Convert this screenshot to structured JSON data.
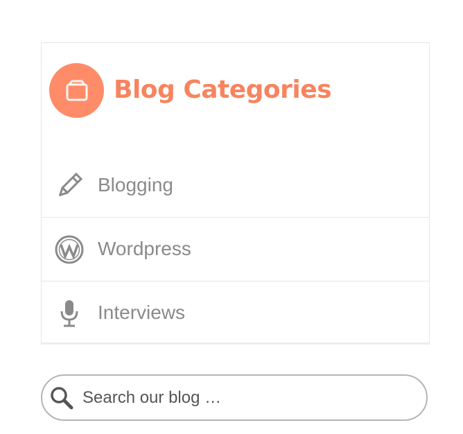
{
  "widget": {
    "title": "Blog Categories",
    "title_icon": "folder-icon",
    "accent_color": "#f7845f",
    "categories": [
      {
        "label": "Blogging",
        "icon": "pencil-icon"
      },
      {
        "label": "Wordpress",
        "icon": "wordpress-icon"
      },
      {
        "label": "Interviews",
        "icon": "microphone-icon"
      }
    ]
  },
  "search": {
    "placeholder": "Search our blog …",
    "value": "",
    "icon": "search-icon"
  }
}
